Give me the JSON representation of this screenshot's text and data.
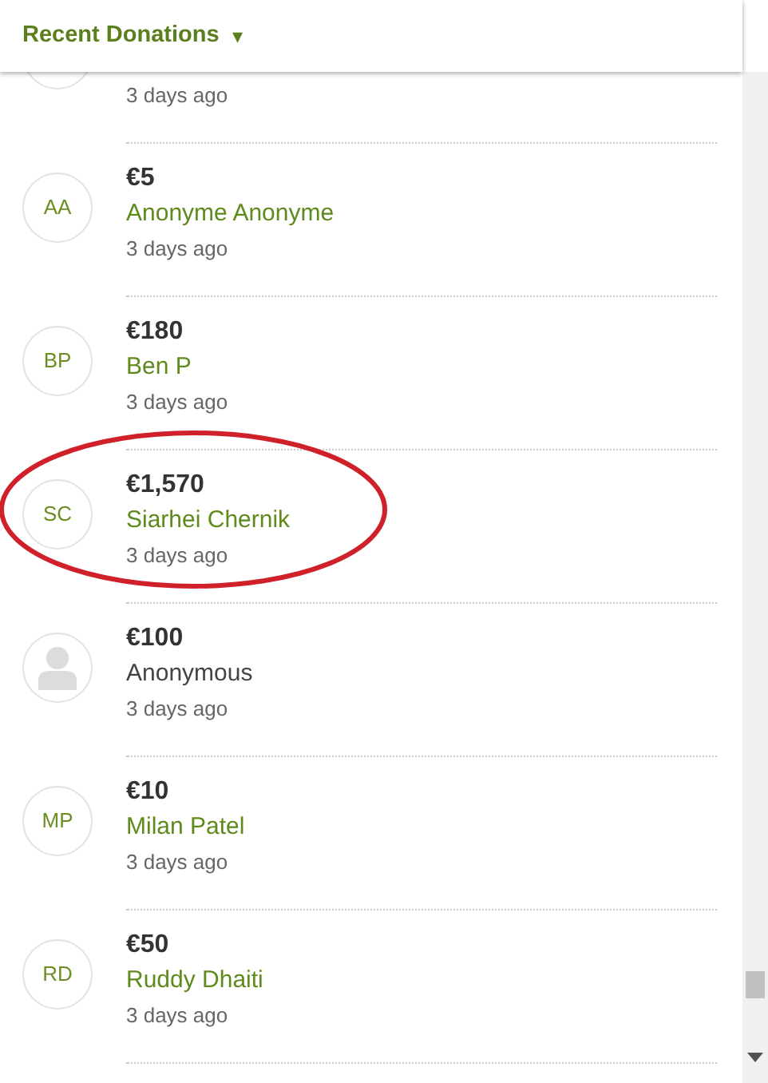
{
  "header": {
    "title": "Recent Donations",
    "caret": "▾"
  },
  "donations": [
    {
      "kind": "cut",
      "time": "3 days ago",
      "highlighted": false
    },
    {
      "kind": "initials",
      "initials": "AA",
      "amount": "€5",
      "name": "Anonyme Anonyme",
      "time": "3 days ago",
      "highlighted": false
    },
    {
      "kind": "initials",
      "initials": "BP",
      "amount": "€180",
      "name": "Ben P",
      "time": "3 days ago",
      "highlighted": false
    },
    {
      "kind": "initials",
      "initials": "SC",
      "amount": "€1,570",
      "name": "Siarhei Chernik",
      "time": "3 days ago",
      "highlighted": true
    },
    {
      "kind": "anonymous",
      "amount": "€100",
      "name": "Anonymous",
      "time": "3 days ago",
      "highlighted": false
    },
    {
      "kind": "initials",
      "initials": "MP",
      "amount": "€10",
      "name": "Milan Patel",
      "time": "3 days ago",
      "highlighted": false
    },
    {
      "kind": "initials",
      "initials": "RD",
      "amount": "€50",
      "name": "Ruddy Dhaiti",
      "time": "3 days ago",
      "highlighted": false
    }
  ]
}
